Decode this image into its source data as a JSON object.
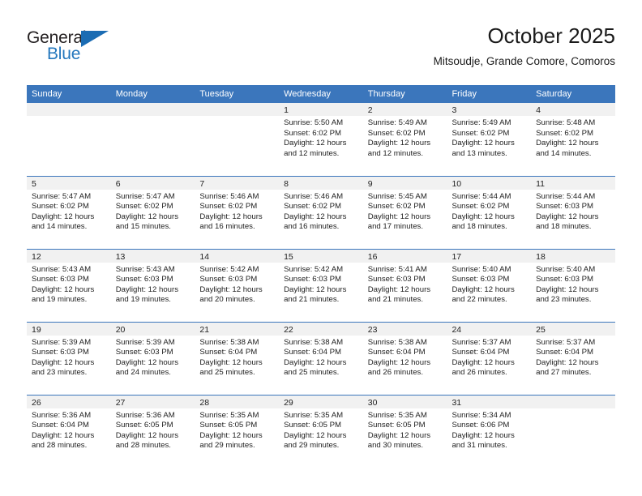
{
  "brand": {
    "word1": "General",
    "word2": "Blue",
    "triangle_color": "#1b6cb3",
    "blue_text_color": "#2477bd"
  },
  "header": {
    "title": "October 2025",
    "subtitle": "Mitsoudje, Grande Comore, Comoros"
  },
  "theme": {
    "header_blue": "#3b76bc",
    "daynum_band": "#f1f1f1",
    "text": "#222222"
  },
  "calendar": {
    "weekday_headers": [
      "Sunday",
      "Monday",
      "Tuesday",
      "Wednesday",
      "Thursday",
      "Friday",
      "Saturday"
    ],
    "weeks": [
      [
        {
          "day": "",
          "empty": true,
          "sunrise": "",
          "sunset": "",
          "daylight1": "",
          "daylight2": ""
        },
        {
          "day": "",
          "empty": true,
          "sunrise": "",
          "sunset": "",
          "daylight1": "",
          "daylight2": ""
        },
        {
          "day": "",
          "empty": true,
          "sunrise": "",
          "sunset": "",
          "daylight1": "",
          "daylight2": ""
        },
        {
          "day": "1",
          "sunrise": "Sunrise: 5:50 AM",
          "sunset": "Sunset: 6:02 PM",
          "daylight1": "Daylight: 12 hours",
          "daylight2": "and 12 minutes."
        },
        {
          "day": "2",
          "sunrise": "Sunrise: 5:49 AM",
          "sunset": "Sunset: 6:02 PM",
          "daylight1": "Daylight: 12 hours",
          "daylight2": "and 12 minutes."
        },
        {
          "day": "3",
          "sunrise": "Sunrise: 5:49 AM",
          "sunset": "Sunset: 6:02 PM",
          "daylight1": "Daylight: 12 hours",
          "daylight2": "and 13 minutes."
        },
        {
          "day": "4",
          "sunrise": "Sunrise: 5:48 AM",
          "sunset": "Sunset: 6:02 PM",
          "daylight1": "Daylight: 12 hours",
          "daylight2": "and 14 minutes."
        }
      ],
      [
        {
          "day": "5",
          "sunrise": "Sunrise: 5:47 AM",
          "sunset": "Sunset: 6:02 PM",
          "daylight1": "Daylight: 12 hours",
          "daylight2": "and 14 minutes."
        },
        {
          "day": "6",
          "sunrise": "Sunrise: 5:47 AM",
          "sunset": "Sunset: 6:02 PM",
          "daylight1": "Daylight: 12 hours",
          "daylight2": "and 15 minutes."
        },
        {
          "day": "7",
          "sunrise": "Sunrise: 5:46 AM",
          "sunset": "Sunset: 6:02 PM",
          "daylight1": "Daylight: 12 hours",
          "daylight2": "and 16 minutes."
        },
        {
          "day": "8",
          "sunrise": "Sunrise: 5:46 AM",
          "sunset": "Sunset: 6:02 PM",
          "daylight1": "Daylight: 12 hours",
          "daylight2": "and 16 minutes."
        },
        {
          "day": "9",
          "sunrise": "Sunrise: 5:45 AM",
          "sunset": "Sunset: 6:02 PM",
          "daylight1": "Daylight: 12 hours",
          "daylight2": "and 17 minutes."
        },
        {
          "day": "10",
          "sunrise": "Sunrise: 5:44 AM",
          "sunset": "Sunset: 6:02 PM",
          "daylight1": "Daylight: 12 hours",
          "daylight2": "and 18 minutes."
        },
        {
          "day": "11",
          "sunrise": "Sunrise: 5:44 AM",
          "sunset": "Sunset: 6:03 PM",
          "daylight1": "Daylight: 12 hours",
          "daylight2": "and 18 minutes."
        }
      ],
      [
        {
          "day": "12",
          "sunrise": "Sunrise: 5:43 AM",
          "sunset": "Sunset: 6:03 PM",
          "daylight1": "Daylight: 12 hours",
          "daylight2": "and 19 minutes."
        },
        {
          "day": "13",
          "sunrise": "Sunrise: 5:43 AM",
          "sunset": "Sunset: 6:03 PM",
          "daylight1": "Daylight: 12 hours",
          "daylight2": "and 19 minutes."
        },
        {
          "day": "14",
          "sunrise": "Sunrise: 5:42 AM",
          "sunset": "Sunset: 6:03 PM",
          "daylight1": "Daylight: 12 hours",
          "daylight2": "and 20 minutes."
        },
        {
          "day": "15",
          "sunrise": "Sunrise: 5:42 AM",
          "sunset": "Sunset: 6:03 PM",
          "daylight1": "Daylight: 12 hours",
          "daylight2": "and 21 minutes."
        },
        {
          "day": "16",
          "sunrise": "Sunrise: 5:41 AM",
          "sunset": "Sunset: 6:03 PM",
          "daylight1": "Daylight: 12 hours",
          "daylight2": "and 21 minutes."
        },
        {
          "day": "17",
          "sunrise": "Sunrise: 5:40 AM",
          "sunset": "Sunset: 6:03 PM",
          "daylight1": "Daylight: 12 hours",
          "daylight2": "and 22 minutes."
        },
        {
          "day": "18",
          "sunrise": "Sunrise: 5:40 AM",
          "sunset": "Sunset: 6:03 PM",
          "daylight1": "Daylight: 12 hours",
          "daylight2": "and 23 minutes."
        }
      ],
      [
        {
          "day": "19",
          "sunrise": "Sunrise: 5:39 AM",
          "sunset": "Sunset: 6:03 PM",
          "daylight1": "Daylight: 12 hours",
          "daylight2": "and 23 minutes."
        },
        {
          "day": "20",
          "sunrise": "Sunrise: 5:39 AM",
          "sunset": "Sunset: 6:03 PM",
          "daylight1": "Daylight: 12 hours",
          "daylight2": "and 24 minutes."
        },
        {
          "day": "21",
          "sunrise": "Sunrise: 5:38 AM",
          "sunset": "Sunset: 6:04 PM",
          "daylight1": "Daylight: 12 hours",
          "daylight2": "and 25 minutes."
        },
        {
          "day": "22",
          "sunrise": "Sunrise: 5:38 AM",
          "sunset": "Sunset: 6:04 PM",
          "daylight1": "Daylight: 12 hours",
          "daylight2": "and 25 minutes."
        },
        {
          "day": "23",
          "sunrise": "Sunrise: 5:38 AM",
          "sunset": "Sunset: 6:04 PM",
          "daylight1": "Daylight: 12 hours",
          "daylight2": "and 26 minutes."
        },
        {
          "day": "24",
          "sunrise": "Sunrise: 5:37 AM",
          "sunset": "Sunset: 6:04 PM",
          "daylight1": "Daylight: 12 hours",
          "daylight2": "and 26 minutes."
        },
        {
          "day": "25",
          "sunrise": "Sunrise: 5:37 AM",
          "sunset": "Sunset: 6:04 PM",
          "daylight1": "Daylight: 12 hours",
          "daylight2": "and 27 minutes."
        }
      ],
      [
        {
          "day": "26",
          "sunrise": "Sunrise: 5:36 AM",
          "sunset": "Sunset: 6:04 PM",
          "daylight1": "Daylight: 12 hours",
          "daylight2": "and 28 minutes."
        },
        {
          "day": "27",
          "sunrise": "Sunrise: 5:36 AM",
          "sunset": "Sunset: 6:05 PM",
          "daylight1": "Daylight: 12 hours",
          "daylight2": "and 28 minutes."
        },
        {
          "day": "28",
          "sunrise": "Sunrise: 5:35 AM",
          "sunset": "Sunset: 6:05 PM",
          "daylight1": "Daylight: 12 hours",
          "daylight2": "and 29 minutes."
        },
        {
          "day": "29",
          "sunrise": "Sunrise: 5:35 AM",
          "sunset": "Sunset: 6:05 PM",
          "daylight1": "Daylight: 12 hours",
          "daylight2": "and 29 minutes."
        },
        {
          "day": "30",
          "sunrise": "Sunrise: 5:35 AM",
          "sunset": "Sunset: 6:05 PM",
          "daylight1": "Daylight: 12 hours",
          "daylight2": "and 30 minutes."
        },
        {
          "day": "31",
          "sunrise": "Sunrise: 5:34 AM",
          "sunset": "Sunset: 6:06 PM",
          "daylight1": "Daylight: 12 hours",
          "daylight2": "and 31 minutes."
        },
        {
          "day": "",
          "empty": true,
          "sunrise": "",
          "sunset": "",
          "daylight1": "",
          "daylight2": ""
        }
      ]
    ]
  }
}
